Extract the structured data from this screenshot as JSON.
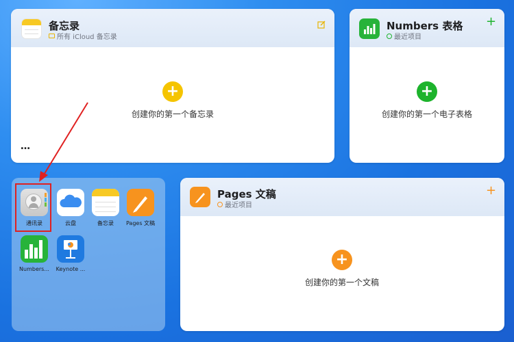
{
  "notes_card": {
    "title": "备忘录",
    "subtitle": "所有 iCloud 备忘录",
    "empty_text": "创建你的第一个备忘录",
    "more": "…"
  },
  "numbers_card": {
    "title": "Numbers 表格",
    "subtitle": "最近项目",
    "empty_text": "创建你的第一个电子表格",
    "add": "+"
  },
  "pages_card": {
    "title": "Pages 文稿",
    "subtitle": "最近项目",
    "empty_text": "创建你的第一个文稿",
    "add": "+"
  },
  "plus_symbol": "+",
  "dock_apps": [
    {
      "label": "通讯录"
    },
    {
      "label": "云盘"
    },
    {
      "label": "备忘录"
    },
    {
      "label": "Pages 文稿"
    },
    {
      "label": "Numbers..."
    },
    {
      "label": "Keynote ..."
    }
  ],
  "colors": {
    "notes_accent": "#f5c400",
    "numbers_accent": "#1db32c",
    "pages_accent": "#f7931e",
    "annotation_red": "#e02020"
  }
}
